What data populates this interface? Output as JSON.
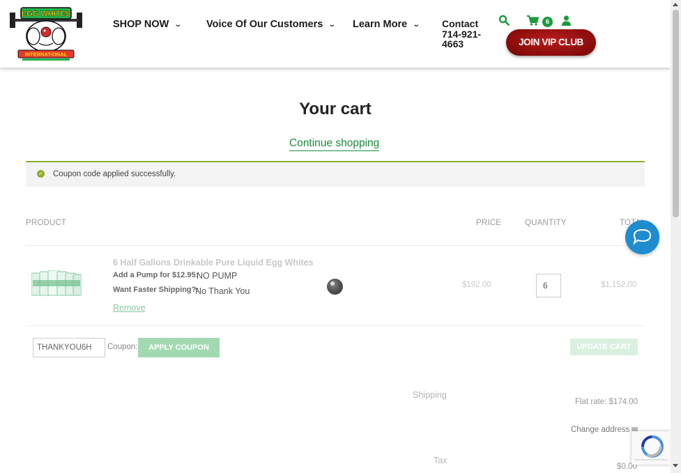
{
  "header": {
    "logo_text": "EGG WHITES INTERNATIONAL",
    "nav": [
      {
        "label": "SHOP NOW"
      },
      {
        "label": "Voice Of Our Customers"
      },
      {
        "label": "Learn More"
      }
    ],
    "contact_label": "Contact",
    "contact_phone": "714-921-4663",
    "cart_count": "6",
    "vip_button": "JOIN VIP CLUB",
    "icons": [
      "search-icon",
      "cart-icon",
      "user-icon",
      "chevron-down-icon"
    ]
  },
  "page": {
    "title": "Your cart",
    "continue_link": "Continue shopping",
    "notice": "Coupon code applied successfully."
  },
  "table": {
    "headers": [
      "PRODUCT",
      "PRICE",
      "QUANTITY",
      "TOTAL"
    ],
    "item": {
      "name": "6 Half Gallons Drinkable Pure Liquid Egg Whites",
      "meta": [
        {
          "label": "Add a Pump for $12.95:",
          "value": "NO PUMP"
        },
        {
          "label": "Want Faster Shipping?:",
          "value": "No Thank You"
        }
      ],
      "remove": "Remove",
      "price": "$192.00",
      "quantity": "6",
      "subtotal": "$1,152.00"
    }
  },
  "coupon": {
    "code": "THANKYOU6H",
    "label": "Coupon:",
    "apply_button": "APPLY COUPON",
    "update_button": "UPDATE CART"
  },
  "totals": {
    "shipping_label": "Shipping",
    "shipping_value": "Flat rate: $174.00",
    "change_address": "Change address",
    "tax_label": "Tax",
    "tax_value": "$0.00"
  },
  "colors": {
    "brand_green": "#1a9a3a",
    "vip_red": "#8a0c0c",
    "chat_blue": "#1f8cd0",
    "notice_border": "#8fae2a"
  }
}
